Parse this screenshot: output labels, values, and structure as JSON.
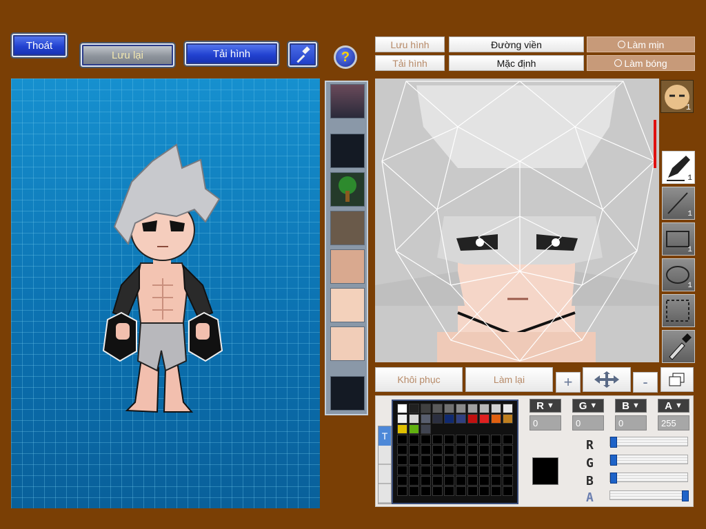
{
  "toolbar": {
    "exit_label": "Thoát",
    "save_label": "Lưu lại",
    "load_label": "Tải hình",
    "tool_icon": "hammer-icon",
    "help_label": "?"
  },
  "editor_panel": {
    "save_image_label": "Lưu hình",
    "load_image_label": "Tải hình",
    "outline_label": "Đường viền",
    "default_label": "Mặc định",
    "smooth_label": "Làm mịn",
    "shade_label": "Làm bóng"
  },
  "tools": [
    {
      "name": "pen-tool",
      "count": "1"
    },
    {
      "name": "line-tool",
      "count": "1"
    },
    {
      "name": "rectangle-tool",
      "count": "1"
    },
    {
      "name": "ellipse-tool",
      "count": "1"
    },
    {
      "name": "selection-tool",
      "count": ""
    },
    {
      "name": "eyedropper-tool",
      "count": ""
    }
  ],
  "face_badge": "1",
  "actions": {
    "restore_label": "Khôi phục",
    "redo_label": "Làm lại",
    "zoom_in": "+",
    "zoom_out": "-"
  },
  "color": {
    "r_label": "R",
    "g_label": "G",
    "b_label": "B",
    "a_label": "A",
    "r": "0",
    "g": "0",
    "b": "0",
    "a": "255",
    "current": "#000000",
    "r_fraction": 0.0,
    "g_fraction": 0.0,
    "b_fraction": 0.0,
    "a_fraction": 1.0,
    "palette": [
      "#ffffff",
      "#202020",
      "#404040",
      "#5a5a5a",
      "#707070",
      "#8a8a8a",
      "#a0a0a0",
      "#b8b8b8",
      "#d0d0d0",
      "#e8e8e8",
      "#f0f0f0",
      "#d8d8d8",
      "#585e6e",
      "#2b2f40",
      "#102a70",
      "#304080",
      "#c01010",
      "#e02020",
      "#e06010",
      "#c08020",
      "#e0c000",
      "#60b010",
      "#404450"
    ]
  },
  "tab_marker": "T",
  "colors": {
    "background": "#7a3f05",
    "canvas": "#0f76b5",
    "accent_blue": "#2242d0"
  }
}
